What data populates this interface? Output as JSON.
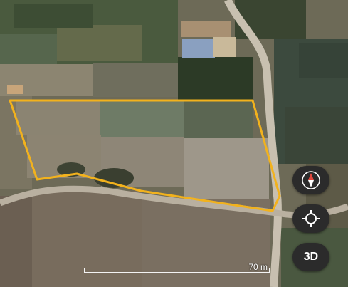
{
  "map": {
    "type": "satellite",
    "boundary_color": "#f2b21d"
  },
  "controls": {
    "compass_icon": "compass-icon",
    "locate_icon": "my-location-icon",
    "view_3d_label": "3D"
  },
  "scale": {
    "label": "70 m"
  }
}
